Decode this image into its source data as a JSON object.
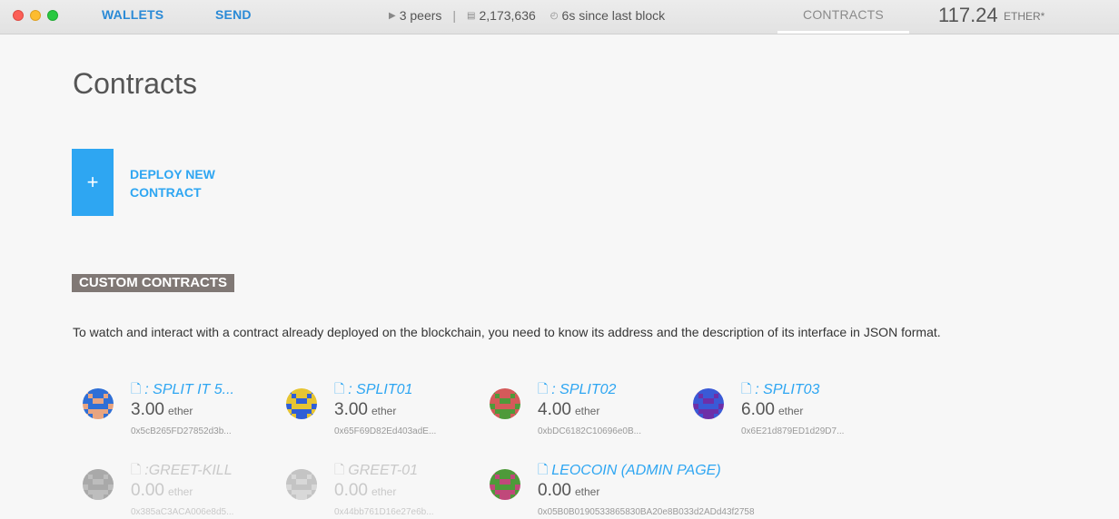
{
  "window": {
    "nav": {
      "wallets": "WALLETS",
      "send": "SEND",
      "contracts": "CONTRACTS"
    },
    "status": {
      "peers": "3 peers",
      "blocks": "2,173,636",
      "since_block": "6s since last block"
    },
    "balance": {
      "amount": "117.24",
      "unit": "ETHER*"
    }
  },
  "page": {
    "title": "Contracts",
    "deploy": {
      "plus": "+",
      "label": "DEPLOY NEW CONTRACT"
    },
    "section": {
      "title": "CUSTOM CONTRACTS"
    },
    "description": "To watch and interact with a contract already deployed on the blockchain, you need to know its address and the description of its interface in JSON format."
  },
  "contracts": [
    {
      "name": ": SPLIT IT 5...",
      "amount": "3.00",
      "unit": "ether",
      "address": "0x5cB265FD27852d3b...",
      "dim": false,
      "colors": [
        "#e8a480",
        "#2f6fd6",
        "#e8a480"
      ]
    },
    {
      "name": ": SPLIT01",
      "amount": "3.00",
      "unit": "ether",
      "address": "0x65F69D82Ed403adE...",
      "dim": false,
      "colors": [
        "#2f5ed6",
        "#e6c432",
        "#2f5ed6"
      ]
    },
    {
      "name": ": SPLIT02",
      "amount": "4.00",
      "unit": "ether",
      "address": "0xbDC6182C10696e0B...",
      "dim": false,
      "colors": [
        "#4e9a3a",
        "#d45a5a",
        "#4e9a3a"
      ]
    },
    {
      "name": ": SPLIT03",
      "amount": "6.00",
      "unit": "ether",
      "address": "0x6E21d879ED1d29D7...",
      "dim": false,
      "colors": [
        "#6d2fa8",
        "#3a5ad6",
        "#6d2fa8"
      ]
    },
    {
      "name": ":GREET-KILL",
      "amount": "0.00",
      "unit": "ether",
      "address": "0x385aC3ACA006e8d5...",
      "dim": true,
      "colors": [
        "#bdbdbd",
        "#a9a9a9",
        "#bdbdbd"
      ]
    },
    {
      "name": "GREET-01",
      "amount": "0.00",
      "unit": "ether",
      "address": "0x44bb761D16e27e6b...",
      "dim": true,
      "colors": [
        "#d8d8d8",
        "#c4c4c4",
        "#d8d8d8"
      ]
    },
    {
      "name": "LEOCOIN (ADMIN PAGE)",
      "amount": "0.00",
      "unit": "ether",
      "address": "0x05B0B0190533865830BA20e8B033d2ADd43f2758",
      "dim": false,
      "colors": [
        "#c0487a",
        "#4e9a3a",
        "#c0487a"
      ]
    }
  ]
}
